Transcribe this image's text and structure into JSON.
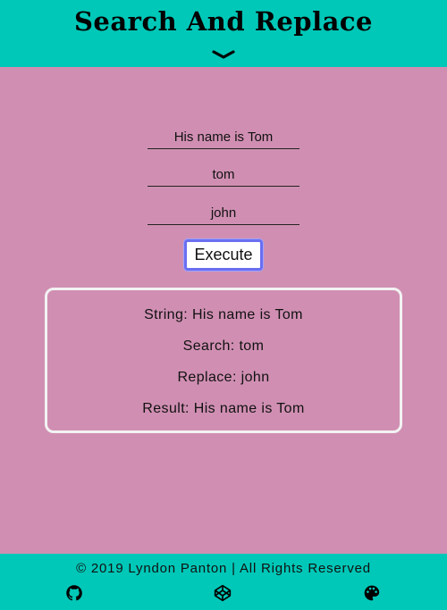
{
  "header": {
    "title": "Search And Replace",
    "toggle_icon": "chevron-down-icon"
  },
  "form": {
    "string_value": "His name is Tom",
    "search_value": "tom",
    "replace_value": "john",
    "execute_label": "Execute"
  },
  "results": {
    "string_line": "String: His name is Tom",
    "search_line": "Search: tom",
    "replace_line": "Replace: john",
    "result_line": "Result: His name is Tom"
  },
  "footer": {
    "copyright": "© 2019 Lyndon Panton | All Rights Reserved",
    "icons": [
      "github-icon",
      "codepen-icon",
      "palette-icon"
    ]
  },
  "colors": {
    "background": "#d08fb2",
    "header": "#00c8b8",
    "button_border": "#6a6ef0"
  }
}
